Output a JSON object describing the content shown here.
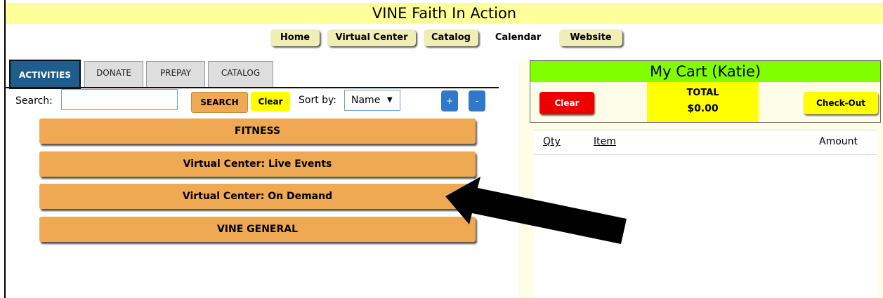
{
  "header": {
    "title": "VINE Faith In Action"
  },
  "nav": [
    {
      "label": "Home"
    },
    {
      "label": "Virtual Center"
    },
    {
      "label": "Catalog"
    },
    {
      "label": "Calendar"
    },
    {
      "label": "Website"
    }
  ],
  "tabs": [
    {
      "label": "ACTIVITIES",
      "active": true
    },
    {
      "label": "DONATE"
    },
    {
      "label": "PREPAY"
    },
    {
      "label": "CATALOG"
    }
  ],
  "search": {
    "label": "Search:",
    "value": "",
    "search_button": "SEARCH",
    "clear_button": "Clear",
    "sort_label": "Sort by:",
    "sort_value": "Name",
    "plus_button": "+",
    "minus_button": "-"
  },
  "categories": [
    {
      "label": "FITNESS"
    },
    {
      "label": "Virtual Center: Live Events"
    },
    {
      "label": "Virtual Center: On Demand"
    },
    {
      "label": "VINE GENERAL"
    }
  ],
  "cart": {
    "title": "My Cart (Katie)",
    "clear_button": "Clear",
    "total_label": "TOTAL",
    "total_value": "$0.00",
    "checkout_button": "Check-Out",
    "columns": {
      "qty": "Qty",
      "item": "Item",
      "amount": "Amount"
    }
  },
  "colors": {
    "title_bar": "#ffff99",
    "active_tab": "#1f5e8c",
    "category_button": "#eea952",
    "cart_title": "#80ff00",
    "clear_red": "#ee0000",
    "yellow": "#ffff00"
  },
  "annotation": {
    "icon": "arrow-pointing-icon"
  }
}
